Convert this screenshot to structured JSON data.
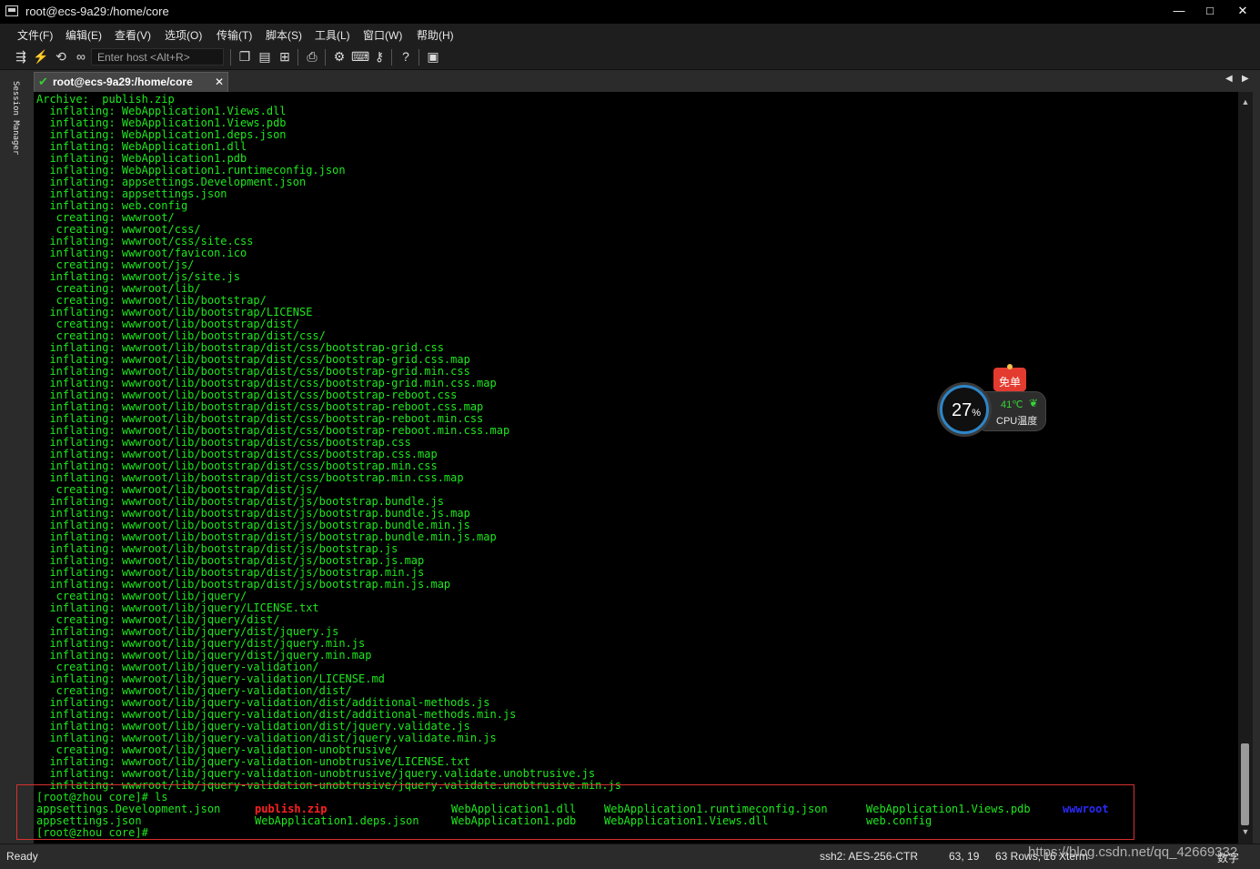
{
  "window": {
    "title": "root@ecs-9a29:/home/core",
    "minimize": "—",
    "maximize": "□",
    "close": "✕"
  },
  "menu": [
    "文件(F)",
    "编辑(E)",
    "查看(V)",
    "选项(O)",
    "传输(T)",
    "脚本(S)",
    "工具(L)",
    "窗口(W)",
    "帮助(H)"
  ],
  "toolbar": {
    "host_placeholder": "Enter host <Alt+R>",
    "icons": [
      "connect-icon",
      "quick-connect-icon",
      "reconnect-icon",
      "link-icon",
      "copy-icon",
      "paste-icon",
      "find-icon",
      "print-icon",
      "settings-icon",
      "keymap-icon",
      "key-icon",
      "help-icon",
      "sftp-icon"
    ]
  },
  "session_manager": {
    "label": "Session Manager"
  },
  "tab": {
    "label": "root@ecs-9a29:/home/core",
    "close": "✕"
  },
  "terminal": {
    "lines": [
      "Archive:  publish.zip",
      "  inflating: WebApplication1.Views.dll",
      "  inflating: WebApplication1.Views.pdb",
      "  inflating: WebApplication1.deps.json",
      "  inflating: WebApplication1.dll",
      "  inflating: WebApplication1.pdb",
      "  inflating: WebApplication1.runtimeconfig.json",
      "  inflating: appsettings.Development.json",
      "  inflating: appsettings.json",
      "  inflating: web.config",
      "   creating: wwwroot/",
      "   creating: wwwroot/css/",
      "  inflating: wwwroot/css/site.css",
      "  inflating: wwwroot/favicon.ico",
      "   creating: wwwroot/js/",
      "  inflating: wwwroot/js/site.js",
      "   creating: wwwroot/lib/",
      "   creating: wwwroot/lib/bootstrap/",
      "  inflating: wwwroot/lib/bootstrap/LICENSE",
      "   creating: wwwroot/lib/bootstrap/dist/",
      "   creating: wwwroot/lib/bootstrap/dist/css/",
      "  inflating: wwwroot/lib/bootstrap/dist/css/bootstrap-grid.css",
      "  inflating: wwwroot/lib/bootstrap/dist/css/bootstrap-grid.css.map",
      "  inflating: wwwroot/lib/bootstrap/dist/css/bootstrap-grid.min.css",
      "  inflating: wwwroot/lib/bootstrap/dist/css/bootstrap-grid.min.css.map",
      "  inflating: wwwroot/lib/bootstrap/dist/css/bootstrap-reboot.css",
      "  inflating: wwwroot/lib/bootstrap/dist/css/bootstrap-reboot.css.map",
      "  inflating: wwwroot/lib/bootstrap/dist/css/bootstrap-reboot.min.css",
      "  inflating: wwwroot/lib/bootstrap/dist/css/bootstrap-reboot.min.css.map",
      "  inflating: wwwroot/lib/bootstrap/dist/css/bootstrap.css",
      "  inflating: wwwroot/lib/bootstrap/dist/css/bootstrap.css.map",
      "  inflating: wwwroot/lib/bootstrap/dist/css/bootstrap.min.css",
      "  inflating: wwwroot/lib/bootstrap/dist/css/bootstrap.min.css.map",
      "   creating: wwwroot/lib/bootstrap/dist/js/",
      "  inflating: wwwroot/lib/bootstrap/dist/js/bootstrap.bundle.js",
      "  inflating: wwwroot/lib/bootstrap/dist/js/bootstrap.bundle.js.map",
      "  inflating: wwwroot/lib/bootstrap/dist/js/bootstrap.bundle.min.js",
      "  inflating: wwwroot/lib/bootstrap/dist/js/bootstrap.bundle.min.js.map",
      "  inflating: wwwroot/lib/bootstrap/dist/js/bootstrap.js",
      "  inflating: wwwroot/lib/bootstrap/dist/js/bootstrap.js.map",
      "  inflating: wwwroot/lib/bootstrap/dist/js/bootstrap.min.js",
      "  inflating: wwwroot/lib/bootstrap/dist/js/bootstrap.min.js.map",
      "   creating: wwwroot/lib/jquery/",
      "  inflating: wwwroot/lib/jquery/LICENSE.txt",
      "   creating: wwwroot/lib/jquery/dist/",
      "  inflating: wwwroot/lib/jquery/dist/jquery.js",
      "  inflating: wwwroot/lib/jquery/dist/jquery.min.js",
      "  inflating: wwwroot/lib/jquery/dist/jquery.min.map",
      "   creating: wwwroot/lib/jquery-validation/",
      "  inflating: wwwroot/lib/jquery-validation/LICENSE.md",
      "   creating: wwwroot/lib/jquery-validation/dist/",
      "  inflating: wwwroot/lib/jquery-validation/dist/additional-methods.js",
      "  inflating: wwwroot/lib/jquery-validation/dist/additional-methods.min.js",
      "  inflating: wwwroot/lib/jquery-validation/dist/jquery.validate.js",
      "  inflating: wwwroot/lib/jquery-validation/dist/jquery.validate.min.js",
      "   creating: wwwroot/lib/jquery-validation-unobtrusive/",
      "  inflating: wwwroot/lib/jquery-validation-unobtrusive/LICENSE.txt",
      "  inflating: wwwroot/lib/jquery-validation-unobtrusive/jquery.validate.unobtrusive.js",
      "  inflating: wwwroot/lib/jquery-validation-unobtrusive/jquery.validate.unobtrusive.min.js"
    ],
    "prompt_ls": "[root@zhou core]# ls",
    "ls_files": [
      {
        "name": "appsettings.Development.json",
        "color": "#1ee81e"
      },
      {
        "name": "publish.zip",
        "color": "#ff2020"
      },
      {
        "name": "WebApplication1.dll",
        "color": "#1ee81e"
      },
      {
        "name": "WebApplication1.runtimeconfig.json",
        "color": "#1ee81e"
      },
      {
        "name": "WebApplication1.Views.pdb",
        "color": "#1ee81e"
      },
      {
        "name": "wwwroot",
        "color": "#2a2aff"
      },
      {
        "name": "appsettings.json",
        "color": "#1ee81e"
      },
      {
        "name": "WebApplication1.deps.json",
        "color": "#1ee81e"
      },
      {
        "name": "WebApplication1.pdb",
        "color": "#1ee81e"
      },
      {
        "name": "WebApplication1.Views.dll",
        "color": "#1ee81e"
      },
      {
        "name": "web.config",
        "color": "#1ee81e"
      }
    ],
    "prompt_end": "[root@zhou core]#"
  },
  "cpu_widget": {
    "badge": "免单",
    "percent": "27",
    "percent_sign": "%",
    "temperature": "41℃",
    "label": "CPU温度"
  },
  "statusbar": {
    "ready": "Ready",
    "cipher": "ssh2: AES-256-CTR",
    "position": "63,  19",
    "size": "63 Rows, 16 Xterm",
    "mode": "数字",
    "watermark": "https://blog.csdn.net/qq_42669332"
  },
  "colors": {
    "terminal_fg": "#1ee81e",
    "archive_red": "#ff2020",
    "dir_blue": "#2a2aff",
    "highlight_border": "#d83030"
  }
}
